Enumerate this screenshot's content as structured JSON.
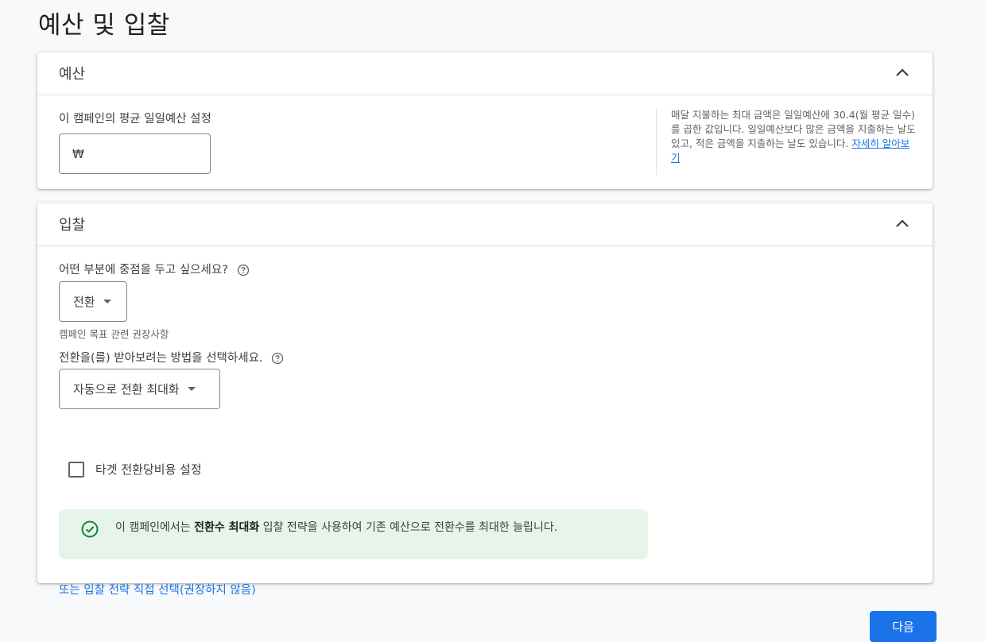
{
  "page": {
    "title": "예산 및 입찰"
  },
  "budget": {
    "title": "예산",
    "field_label": "이 캠페인의 평균 일일예산 설정",
    "currency_symbol": "₩",
    "value": "",
    "help_text": "매달 지불하는 최대 금액은 일일예산에 30.4(월 평균 일수)를 곱한 값입니다. 일일예산보다 많은 금액을 지출하는 날도 있고, 적은 금액을 지출하는 날도 있습니다.",
    "learn_more": "자세히 알아보기"
  },
  "bidding": {
    "title": "입찰",
    "focus_question": "어떤 부분에 중점을 두고 싶으세요?",
    "focus_value": "전환",
    "focus_note": "캠페인 목표 관련 권장사항",
    "method_question": "전환을(를) 받아보려는 방법을 선택하세요.",
    "method_value": "자동으로 전환 최대화",
    "target_cpa_label": "타겟 전환당비용 설정",
    "target_cpa_checked": false,
    "info_prefix": "이 캠페인에서는 ",
    "info_bold": "전환수 최대화",
    "info_suffix": " 입찰 전략을 사용하여 기존 예산으로 전환수를 최대한 늘립니다.",
    "alt_link": "또는 입찰 전략 직접 선택(권장하지 않음)"
  },
  "footer": {
    "next_label": "다음"
  },
  "colors": {
    "accent": "#1a73e8",
    "success_bg": "#e6f4ea",
    "success_icon": "#188038"
  },
  "icons": [
    "chevron-up-icon",
    "help-icon",
    "dropdown-caret-icon",
    "check-circle-icon"
  ]
}
